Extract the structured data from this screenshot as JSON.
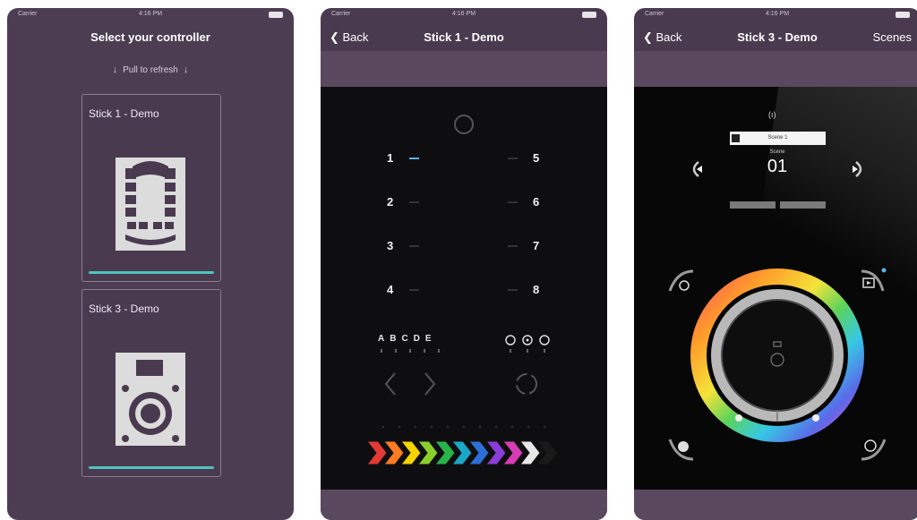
{
  "status": {
    "carrier": "Carrier",
    "time": "4:16 PM"
  },
  "screen1": {
    "title": "Select your controller",
    "pull_text": "Pull to refresh",
    "controllers": [
      {
        "label": "Stick 1 - Demo",
        "icon": "stick1-device-icon"
      },
      {
        "label": "Stick 3 - Demo",
        "icon": "stick3-device-icon"
      }
    ]
  },
  "screen2": {
    "back": "Back",
    "title": "Stick 1 - Demo",
    "zones_left": [
      "1",
      "2",
      "3",
      "4"
    ],
    "zones_right": [
      "5",
      "6",
      "7",
      "8"
    ],
    "letters": "ABCDE",
    "active_zone": "1",
    "color_arrows": [
      "#e53935",
      "#ff7b22",
      "#f5d400",
      "#8ccf2c",
      "#29b34a",
      "#1aa7c7",
      "#2c6fd9",
      "#8a3ed8",
      "#d83cb5",
      "#e8e8e8",
      "#1a1a1a"
    ]
  },
  "screen3": {
    "back": "Back",
    "title": "Stick 3 - Demo",
    "right_action": "Scenes",
    "scene_name": "Scene 1",
    "scene_label": "Scene",
    "scene_number": "01"
  },
  "colors": {
    "panel_purple": "#4a3a4f",
    "accent_teal": "#4ec4c0",
    "zone_active": "#5ab3e6"
  }
}
